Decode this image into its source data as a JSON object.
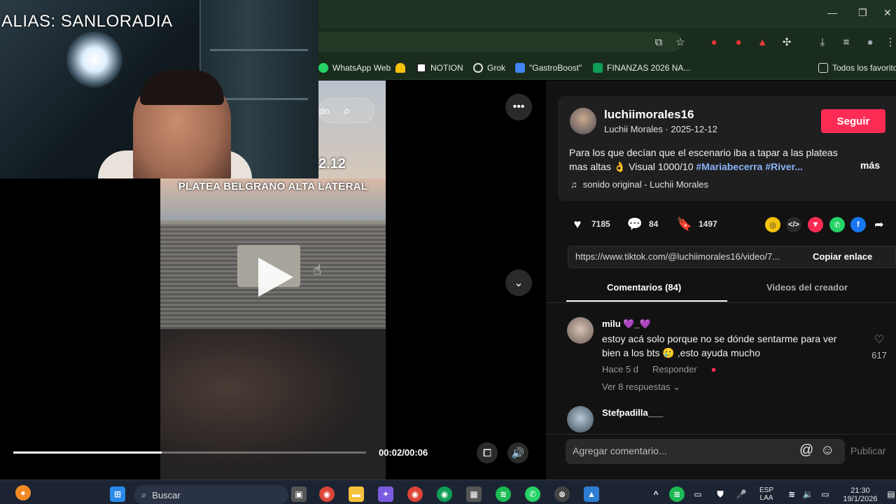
{
  "webcam": {
    "overlay_text": "ALIAS: SANLORADIA"
  },
  "browser": {
    "window_controls": [
      "—",
      "❐",
      "✕"
    ],
    "bookmarks": [
      {
        "label": "WhatsApp Web",
        "icon": "whatsapp-icon",
        "color": "#25d366"
      },
      {
        "label": "",
        "icon": "bell-icon",
        "color": "#f4c20d"
      },
      {
        "label": "NOTION",
        "icon": "notion-icon",
        "color": "#ffffff"
      },
      {
        "label": "Grok",
        "icon": "grok-icon",
        "color": "#dddddd"
      },
      {
        "label": "\"GastroBoost\"",
        "icon": "docs-icon",
        "color": "#4285f4"
      },
      {
        "label": "FINANZAS 2026 NA...",
        "icon": "sheets-icon",
        "color": "#0f9d58"
      }
    ],
    "all_bookmarks": "Todos los favorito"
  },
  "video": {
    "search_partial": "do",
    "date_partial": "2.12",
    "caption": "PLATEA BELGRANO ALTA LATERAL",
    "time": "00:02/00:06",
    "progress": 0.42
  },
  "post": {
    "username": "luchiimorales16",
    "subline": "Luchii Morales · 2025-12-12",
    "follow_label": "Seguir",
    "desc_text": "Para los que decían que el escenario iba a tapar a las plateas mas altas 👌 Visual 1000/10 ",
    "hashtags": "#Mariabecerra #River...",
    "more": "más",
    "music": "sonido original - Luchii Morales",
    "likes": "7185",
    "comments": "84",
    "saves": "1497",
    "link": "https://www.tiktok.com/@luchiimorales16/video/7...",
    "copy_label": "Copiar enlace",
    "tabs": [
      "Comentarios (84)",
      "Videos del creador"
    ]
  },
  "comments": [
    {
      "name": "milu 💜_💜",
      "text": "estoy acá solo porque no se dónde sentarme para ver bien a los bts 🥲 ,esto ayuda mucho",
      "time": "Hace 5 d",
      "reply": "Responder",
      "replies": "Ver 8 respuestas ⌄",
      "likes": "617"
    },
    {
      "name": "Stefpadilla___"
    }
  ],
  "comment_box": {
    "placeholder": "Agregar comentario...",
    "publish": "Publicar"
  },
  "taskbar": {
    "search": "Buscar",
    "lang_top": "ESP",
    "lang_bottom": "LAA",
    "time": "21:30",
    "date": "19/1/2026"
  },
  "colors": {
    "accent": "#fe2c55",
    "hashtag": "#8ab4f8",
    "panel": "#121212"
  }
}
